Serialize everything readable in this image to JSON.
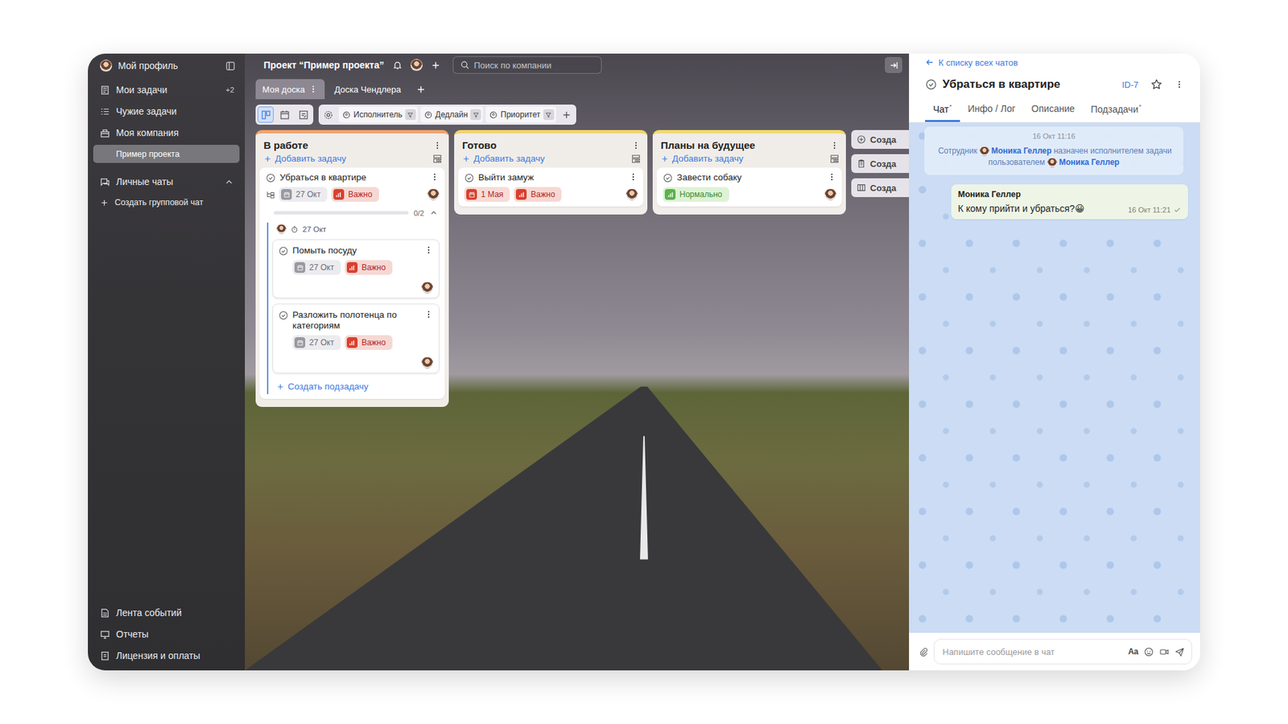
{
  "sidebar": {
    "profile": "Мой профиль",
    "nav": [
      {
        "label": "Мои задачи",
        "count": "+2",
        "kind": "item",
        "selected": false
      },
      {
        "label": "Чужие задачи",
        "count": "",
        "kind": "item",
        "selected": false
      },
      {
        "label": "Моя компания",
        "count": "",
        "kind": "item",
        "selected": false
      },
      {
        "label": "Пример проекта",
        "count": "",
        "kind": "sub",
        "selected": true
      }
    ],
    "chats_section": {
      "label": "Личные чаты",
      "expanded": true,
      "create_label": "Создать групповой чат"
    },
    "bottom": [
      "Лента событий",
      "Отчеты",
      "Лицензия и оплаты"
    ]
  },
  "header": {
    "project_title": "Проект “Пример проекта”",
    "search_placeholder": "Поиск по компании"
  },
  "board_tabs": [
    {
      "label": "Моя доска",
      "selected": true
    },
    {
      "label": "Доска Чендлера",
      "selected": false
    }
  ],
  "toolbar": {
    "views": [
      {
        "selected": true
      },
      {
        "selected": false
      },
      {
        "selected": false
      }
    ],
    "filters": [
      "Исполнитель",
      "Дедлайн",
      "Приоритет"
    ]
  },
  "columns": [
    {
      "title": "В работе",
      "color": "#f2a36a",
      "add_label": "Добавить задачу",
      "cards": [
        {
          "title": "Убраться в квартире",
          "date": "27 Окт",
          "overdue": false,
          "priority": "Важно",
          "priority_kind": "high",
          "has_subtasks": true,
          "subtasks": {
            "progress": "0/2",
            "level": 0,
            "expanded": true,
            "date": "27 Окт",
            "create_label": "Создать подзадачу",
            "items": [
              {
                "title": "Помыть посуду",
                "date": "27 Окт",
                "overdue": false,
                "priority": "Важно",
                "priority_kind": "high"
              },
              {
                "title": "Разложить полотенца по категориям",
                "date": "27 Окт",
                "overdue": false,
                "priority": "Важно",
                "priority_kind": "high"
              }
            ]
          }
        }
      ]
    },
    {
      "title": "Готово",
      "color": "#f3d36b",
      "add_label": "Добавить задачу",
      "cards": [
        {
          "title": "Выйти замуж",
          "date": "1 Мая",
          "overdue": true,
          "priority": "Важно",
          "priority_kind": "high",
          "has_subtasks": false
        }
      ]
    },
    {
      "title": "Планы на будущее",
      "color": "#f1da6e",
      "add_label": "Добавить задачу",
      "cards": [
        {
          "title": "Завести собаку",
          "date": "",
          "overdue": false,
          "priority": "Нормально",
          "priority_kind": "normal",
          "has_subtasks": false
        }
      ]
    }
  ],
  "create_buttons": [
    "Созда",
    "Созда",
    "Созда"
  ],
  "chat": {
    "back_label": "К списку всех чатов",
    "title": "Убраться в квартире",
    "id": "ID-7",
    "starred": false,
    "tabs": [
      {
        "label": "Чат",
        "marker": "*",
        "selected": true
      },
      {
        "label": "Инфо / Лог",
        "marker": "",
        "selected": false
      },
      {
        "label": "Описание",
        "marker": "",
        "selected": false
      },
      {
        "label": "Подзадачи",
        "marker": "*",
        "selected": false
      }
    ],
    "system": {
      "time": "16 Окт 11:16",
      "parts": [
        {
          "text": "Сотрудник",
          "kind": "text"
        },
        {
          "text": "Моника Геллер",
          "kind": "user"
        },
        {
          "text": "назначен исполнителем задачи пользователем",
          "kind": "text"
        },
        {
          "text": "Моника Геллер",
          "kind": "user"
        }
      ]
    },
    "messages": [
      {
        "author": "Моника Геллер",
        "text": "К кому прийти и убраться?😀",
        "time": "16 Окт 11:21",
        "sent": true
      }
    ],
    "input": {
      "placeholder": "Напишите сообщение в чат",
      "format_label": "Aa"
    }
  }
}
